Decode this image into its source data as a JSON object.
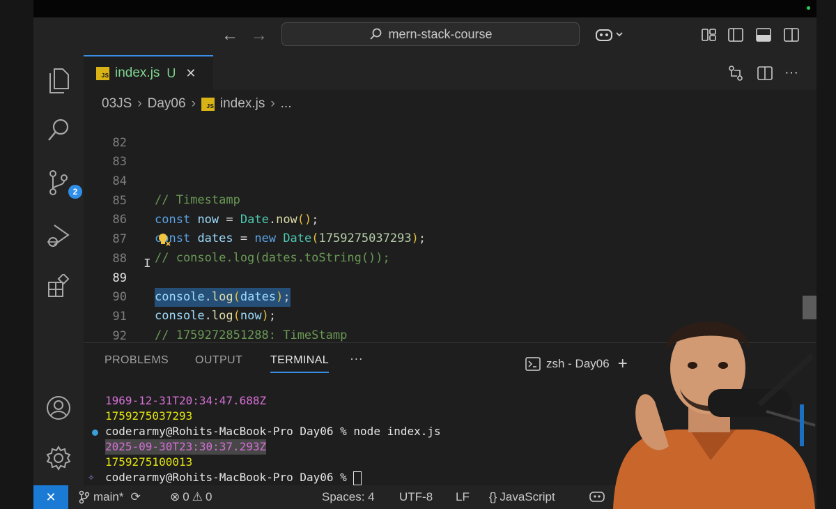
{
  "titlebar": {
    "search_text": "mern-stack-course",
    "back_glyph": "←",
    "forward_glyph": "→"
  },
  "activity": {
    "source_control_badge": "2"
  },
  "tab": {
    "filename": "index.js",
    "status": "U",
    "close_glyph": "✕",
    "lang_badge": "JS"
  },
  "breadcrumb": [
    "03JS",
    "Day06",
    "index.js",
    "..."
  ],
  "editor": {
    "line_numbers": [
      "82",
      "83",
      "84",
      "85",
      "86",
      "87",
      "88",
      "89",
      "90",
      "91",
      "92"
    ],
    "current_line": "89",
    "lines": {
      "l84": "// Timestamp",
      "l85": {
        "kw": "const",
        "var": "now",
        "eq": " = ",
        "cls": "Date",
        "dot": ".",
        "fn": "now",
        "p1": "(",
        "p2": ")",
        "end": ";"
      },
      "l86": {
        "kw": "const",
        "var": "dates",
        "eq": " = ",
        "new": "new",
        "cls": "Date",
        "p1": "(",
        "num": "1759275037293",
        "p2": ")",
        "end": ";"
      },
      "l87": "// console.log(dates.toString());",
      "l89": {
        "obj": "console",
        "dot": ".",
        "fn": "log",
        "p1": "(",
        "arg": "dates",
        "p2": ")",
        "end": ";"
      },
      "l90": {
        "obj": "console",
        "dot": ".",
        "fn": "log",
        "p1": "(",
        "arg": "now",
        "p2": ")",
        "end": ";"
      },
      "l91": "// 1759272851288: TimeStamp"
    }
  },
  "panel": {
    "tabs": [
      "PROBLEMS",
      "OUTPUT",
      "TERMINAL"
    ],
    "active_tab": "TERMINAL",
    "more": "···",
    "terminal_name": "zsh - Day06",
    "add_glyph": "+",
    "lines": [
      {
        "text": "1969-12-31T20:34:47.688Z",
        "color": "magenta"
      },
      {
        "text": "1759275037293",
        "color": "yellow"
      },
      {
        "text": "coderarmy@Rohits-MacBook-Pro Day06 % node index.js",
        "color": "white"
      },
      {
        "text": "2025-09-30T23:30:37.293Z",
        "color": "highlight"
      },
      {
        "text": "1759275100013",
        "color": "yellow"
      },
      {
        "text": "coderarmy@Rohits-MacBook-Pro Day06 % ",
        "color": "white"
      }
    ]
  },
  "statusbar": {
    "remote_glyph": "✕",
    "branch": "main*",
    "errors": "0",
    "warnings": "0",
    "spaces": "Spaces: 4",
    "encoding": "UTF-8",
    "eol": "LF",
    "language": "JavaScript"
  },
  "colors": {
    "accent": "#3a8ee6",
    "remote": "#1a7ad4",
    "selection": "#264f78"
  }
}
